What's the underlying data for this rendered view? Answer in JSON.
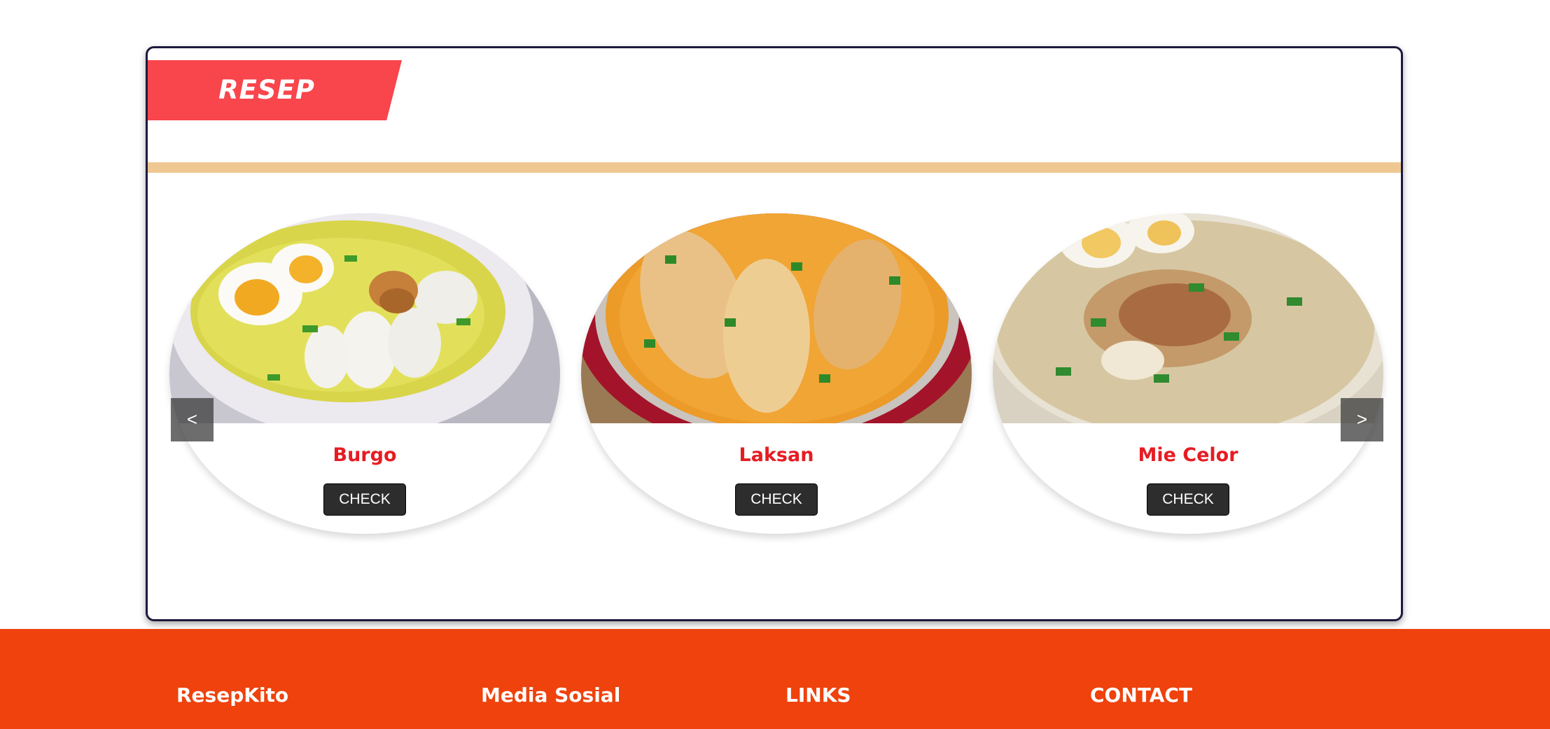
{
  "section": {
    "title": "RESEP"
  },
  "carousel": {
    "prev_label": "<",
    "next_label": ">",
    "items": [
      {
        "name": "Burgo",
        "button": "CHECK",
        "image": "burgo-photo"
      },
      {
        "name": "Laksan",
        "button": "CHECK",
        "image": "laksan-photo"
      },
      {
        "name": "Mie Celor",
        "button": "CHECK",
        "image": "mie-celor-photo"
      }
    ]
  },
  "footer": {
    "columns": [
      "ResepKito",
      "Media Sosial",
      "LINKS",
      "CONTACT"
    ]
  },
  "colors": {
    "ribbon": "#f9454c",
    "divider": "#efc891",
    "recipe_name": "#e61c23",
    "button": "#2d2d2d",
    "footer": "#ef420c"
  }
}
